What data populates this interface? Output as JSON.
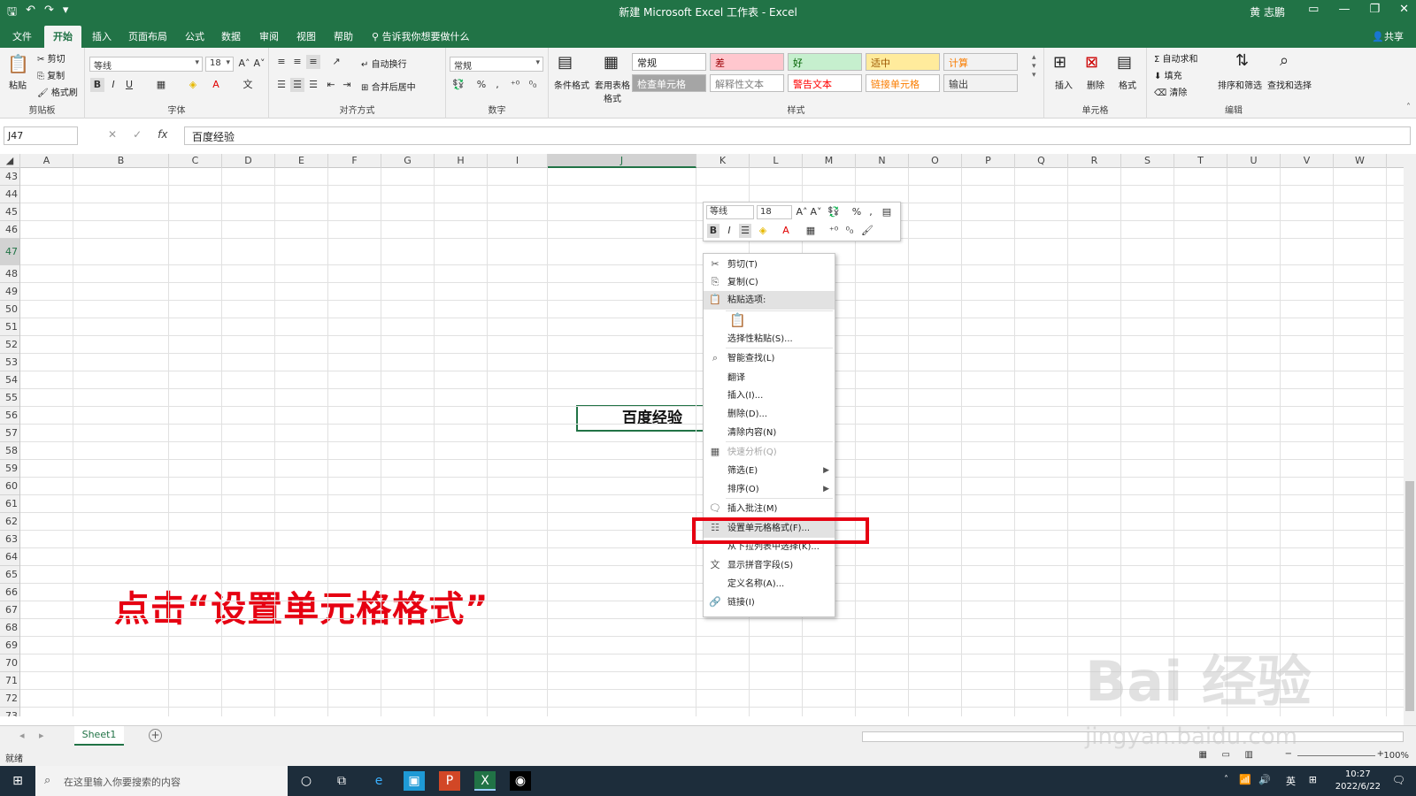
{
  "window": {
    "title": "新建 Microsoft Excel 工作表 - Excel",
    "user": "黄 志鹏"
  },
  "ribbon_tabs": [
    {
      "label": "文件"
    },
    {
      "label": "开始"
    },
    {
      "label": "插入"
    },
    {
      "label": "页面布局"
    },
    {
      "label": "公式"
    },
    {
      "label": "数据"
    },
    {
      "label": "审阅"
    },
    {
      "label": "视图"
    },
    {
      "label": "帮助"
    },
    {
      "label": "告诉我你想要做什么"
    }
  ],
  "share_label": "共享",
  "clipboard": {
    "paste": "粘贴",
    "cut": "剪切",
    "copy": "复制",
    "painter": "格式刷",
    "group": "剪贴板"
  },
  "font": {
    "name": "等线",
    "size": "18",
    "group": "字体",
    "bold": "B",
    "italic": "I",
    "underline": "U"
  },
  "alignment": {
    "wrap": "自动换行",
    "merge": "合并后居中",
    "group": "对齐方式"
  },
  "number": {
    "format": "常规",
    "group": "数字"
  },
  "styles": {
    "cond": "条件格式",
    "table": "套用表格格式",
    "group": "样式",
    "cells": [
      {
        "label": "常规",
        "bg": "#ffffff",
        "fg": "#222222"
      },
      {
        "label": "差",
        "bg": "#ffc7ce",
        "fg": "#9c0006"
      },
      {
        "label": "好",
        "bg": "#c6efce",
        "fg": "#006100"
      },
      {
        "label": "适中",
        "bg": "#ffeb9c",
        "fg": "#9c5700"
      },
      {
        "label": "计算",
        "bg": "#f2f2f2",
        "fg": "#fa7d00"
      },
      {
        "label": "检查单元格",
        "bg": "#a5a5a5",
        "fg": "#ffffff"
      },
      {
        "label": "解释性文本",
        "bg": "#ffffff",
        "fg": "#7f7f7f"
      },
      {
        "label": "警告文本",
        "bg": "#ffffff",
        "fg": "#ff0000"
      },
      {
        "label": "链接单元格",
        "bg": "#ffffff",
        "fg": "#fa7d00"
      },
      {
        "label": "输出",
        "bg": "#f2f2f2",
        "fg": "#3f3f3f"
      }
    ]
  },
  "cells_group": {
    "insert": "插入",
    "delete": "删除",
    "format": "格式",
    "group": "单元格"
  },
  "editing": {
    "autosum": "自动求和",
    "fill": "填充",
    "clear": "清除",
    "sort": "排序和筛选",
    "find": "查找和选择",
    "group": "编辑"
  },
  "formula_bar": {
    "namebox": "J47",
    "fx": "fx",
    "value": "百度经验"
  },
  "columns": [
    "A",
    "B",
    "C",
    "D",
    "E",
    "F",
    "G",
    "H",
    "I",
    "J",
    "K",
    "L",
    "M",
    "N",
    "O",
    "P",
    "Q",
    "R",
    "S",
    "T",
    "U",
    "V",
    "W"
  ],
  "rows": [
    "43",
    "44",
    "45",
    "46",
    "47",
    "48",
    "49",
    "50",
    "51",
    "52",
    "53",
    "54",
    "55",
    "56",
    "57",
    "58",
    "59",
    "60",
    "61",
    "62",
    "63",
    "64",
    "65",
    "66",
    "67",
    "68",
    "69",
    "70",
    "71",
    "72",
    "73",
    "74"
  ],
  "active_cell": {
    "value": "百度经验"
  },
  "annotation": "点击“设置单元格格式”",
  "mini_toolbar": {
    "font": "等线",
    "size": "18"
  },
  "context_menu": [
    {
      "label": "剪切(T)",
      "icon": "scissors-icon",
      "glyph": "✂"
    },
    {
      "label": "复制(C)",
      "icon": "copy-icon",
      "glyph": "⎘"
    },
    {
      "label": "粘贴选项:",
      "icon": "paste-icon",
      "glyph": "📋"
    },
    {
      "label": "选择性粘贴(S)...",
      "icon": "",
      "glyph": ""
    },
    {
      "label": "智能查找(L)",
      "icon": "smart-lookup-icon",
      "glyph": "⌕"
    },
    {
      "label": "翻译",
      "icon": "",
      "glyph": ""
    },
    {
      "label": "插入(I)...",
      "icon": "",
      "glyph": ""
    },
    {
      "label": "删除(D)...",
      "icon": "",
      "glyph": ""
    },
    {
      "label": "清除内容(N)",
      "icon": "",
      "glyph": ""
    },
    {
      "label": "快速分析(Q)",
      "icon": "quick-analysis-icon",
      "glyph": "▦"
    },
    {
      "label": "筛选(E)",
      "icon": "",
      "glyph": ""
    },
    {
      "label": "排序(O)",
      "icon": "",
      "glyph": ""
    },
    {
      "label": "插入批注(M)",
      "icon": "comment-icon",
      "glyph": "🗨"
    },
    {
      "label": "设置单元格格式(F)...",
      "icon": "format-cells-icon",
      "glyph": "☷"
    },
    {
      "label": "从下拉列表中选择(K)...",
      "icon": "",
      "glyph": ""
    },
    {
      "label": "显示拼音字段(S)",
      "icon": "phonetic-icon",
      "glyph": "文"
    },
    {
      "label": "定义名称(A)...",
      "icon": "",
      "glyph": ""
    },
    {
      "label": "链接(I)",
      "icon": "link-icon",
      "glyph": "🔗"
    }
  ],
  "sheet": {
    "tab": "Sheet1"
  },
  "status": {
    "ready": "就绪",
    "zoom": "100%"
  },
  "taskbar": {
    "search": "在这里输入你要搜索的内容",
    "time": "10:27",
    "date": "2022/6/22",
    "ime": "英"
  },
  "watermark": {
    "logo": "Bai 经验",
    "url": "jingyan.baidu.com"
  },
  "colors": {
    "excel_green": "#217346",
    "annotation_red": "#e60012"
  }
}
